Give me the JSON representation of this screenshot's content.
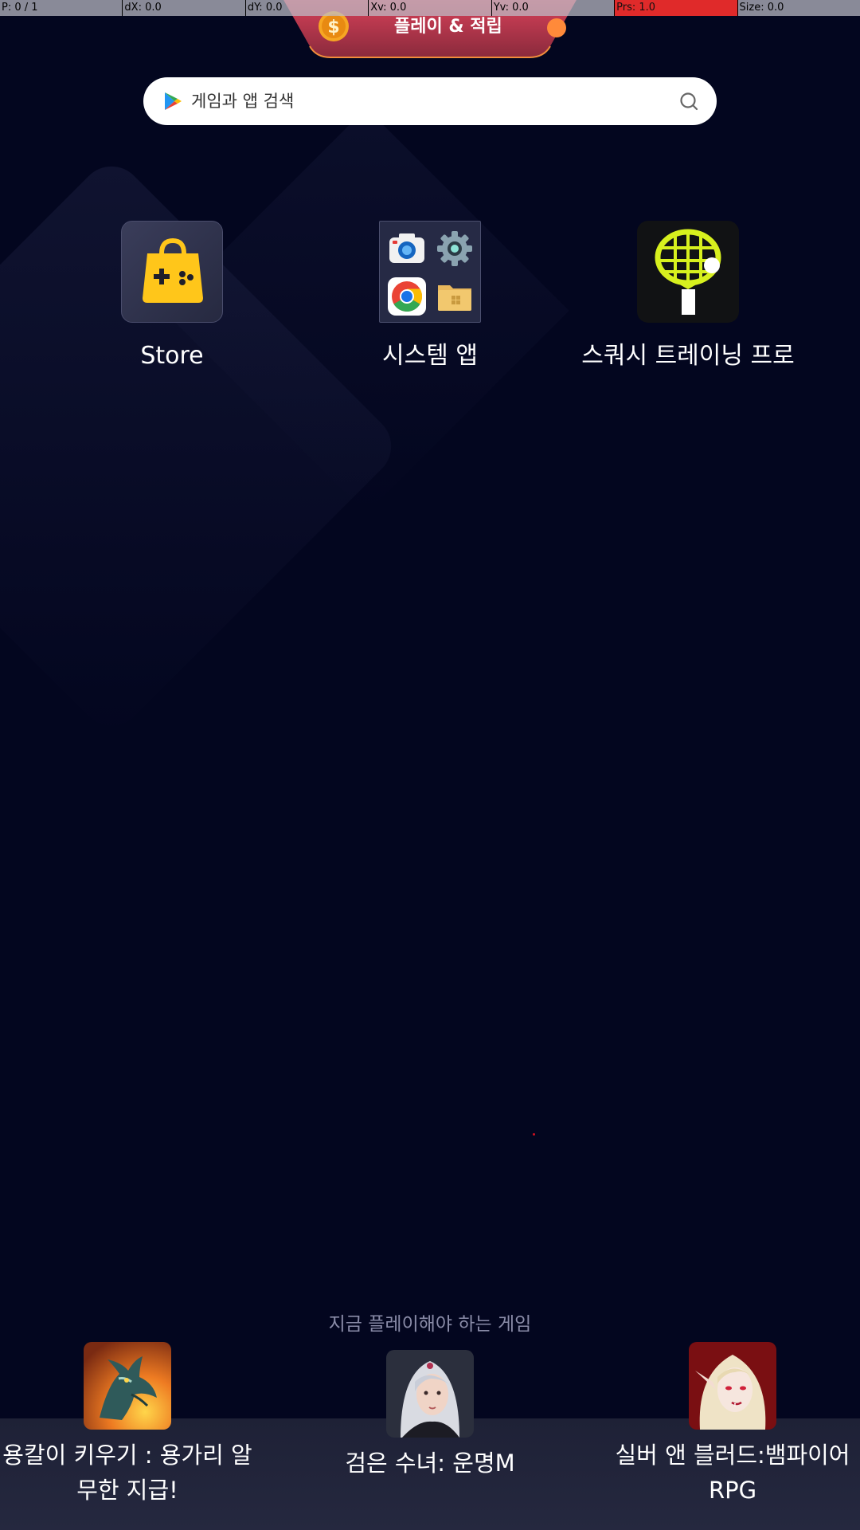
{
  "debug_bar": {
    "p": "P: 0 / 1",
    "dx": "dX: 0.0",
    "dy": "dY: 0.0",
    "xv": "Xv: 0.0",
    "yv": "Yv: 0.0",
    "prs": "Prs: 1.0",
    "size": "Size: 0.0"
  },
  "play_earn": {
    "label": "플레이 & 적립",
    "coin_icon": "dollar-coin-icon",
    "notification_color": "#ff8a3a"
  },
  "search": {
    "placeholder": "게임과 앱 검색",
    "logo_icon": "google-play-icon",
    "search_icon": "magnifier-icon"
  },
  "apps": [
    {
      "label": "Store",
      "icon": "shopping-bag-gamepad-icon"
    },
    {
      "label": "시스템 앱",
      "icon": "system-apps-folder-icon"
    },
    {
      "label": "스쿼시 트레이닝 프로",
      "icon": "squash-racket-icon"
    }
  ],
  "recommended": {
    "title": "지금 플레이해야 하는 게임",
    "games": [
      {
        "label": "용칼이 키우기 : 용가리 알 무한 지급!",
        "icon": "dragon-game-icon"
      },
      {
        "label": "검은 수녀: 운명M",
        "icon": "black-nun-game-icon"
      },
      {
        "label": "실버 앤 블러드:뱀파이어 RPG",
        "icon": "vampire-game-icon"
      }
    ]
  },
  "colors": {
    "background": "#03061f",
    "accent_red": "#e02a2a",
    "tab_gradient_top": "#d9425a",
    "tab_gradient_bottom": "#8a2a3c"
  }
}
